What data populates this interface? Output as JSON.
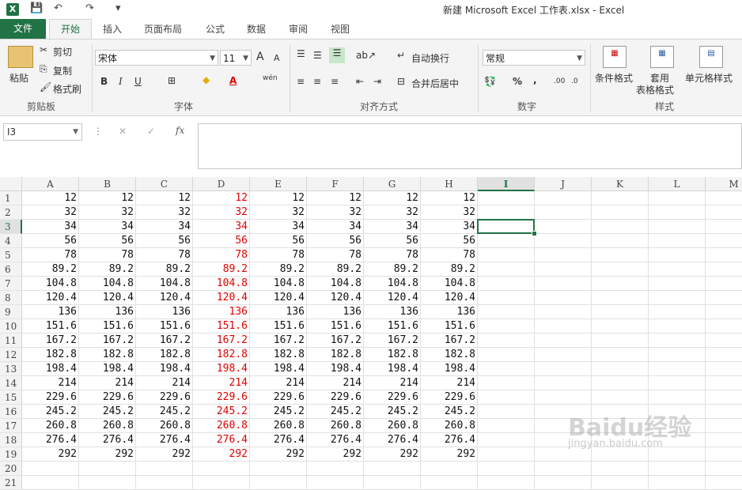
{
  "titlebar": {
    "app_icon": "X",
    "title": "新建 Microsoft Excel 工作表.xlsx - Excel",
    "qat": {
      "save_icon": "💾",
      "undo_icon": "↶",
      "redo_icon": "↷",
      "more_icon": "▾"
    }
  },
  "tabs": {
    "file": "文件",
    "items": [
      "开始",
      "插入",
      "页面布局",
      "公式",
      "数据",
      "审阅",
      "视图"
    ]
  },
  "ribbon": {
    "clipboard": {
      "paste": "粘贴",
      "cut": "剪切",
      "copy": "复制",
      "format_painter": "格式刷",
      "label": "剪贴板"
    },
    "font": {
      "name": "宋体",
      "size": "11",
      "bold": "B",
      "italic": "I",
      "underline": "U",
      "label": "字体",
      "grow": "A",
      "shrink": "A",
      "wen": "wén",
      "font_color_icon": "A"
    },
    "alignment": {
      "wrap": "自动换行",
      "merge": "合并后居中",
      "label": "对齐方式"
    },
    "number": {
      "format": "常规",
      "percent": "%",
      "comma": ",",
      "inc": ".00",
      "dec": ".0",
      "label": "数字"
    },
    "styles": {
      "conditional": "条件格式",
      "table_format_1": "套用",
      "table_format_2": "表格格式",
      "cell_styles": "单元格样式",
      "label": "样式"
    }
  },
  "formula_bar": {
    "name_box": "I3",
    "cancel": "✕",
    "enter": "✓",
    "fx": "fx",
    "value": ""
  },
  "sheet": {
    "columns": [
      "A",
      "B",
      "C",
      "D",
      "E",
      "F",
      "G",
      "H",
      "I",
      "J",
      "K",
      "L",
      "M"
    ],
    "selected_column": "I",
    "selected_row": 3,
    "row_numbers": [
      "1",
      "2",
      "3",
      "4",
      "5",
      "6",
      "7",
      "8",
      "9",
      "10",
      "11",
      "12",
      "13",
      "14",
      "15",
      "16",
      "17",
      "18",
      "19",
      "20",
      "21"
    ],
    "red_column": "D",
    "values": [
      "12",
      "32",
      "34",
      "56",
      "78",
      "89.2",
      "104.8",
      "120.4",
      "136",
      "151.6",
      "167.2",
      "182.8",
      "198.4",
      "214",
      "229.6",
      "245.2",
      "260.8",
      "276.4",
      "292"
    ],
    "colors": {
      "accent": "#217346",
      "red_text": "#e00000"
    }
  },
  "watermark": {
    "line1": "Baidu经验",
    "line2": "jingyan.baidu.com"
  }
}
